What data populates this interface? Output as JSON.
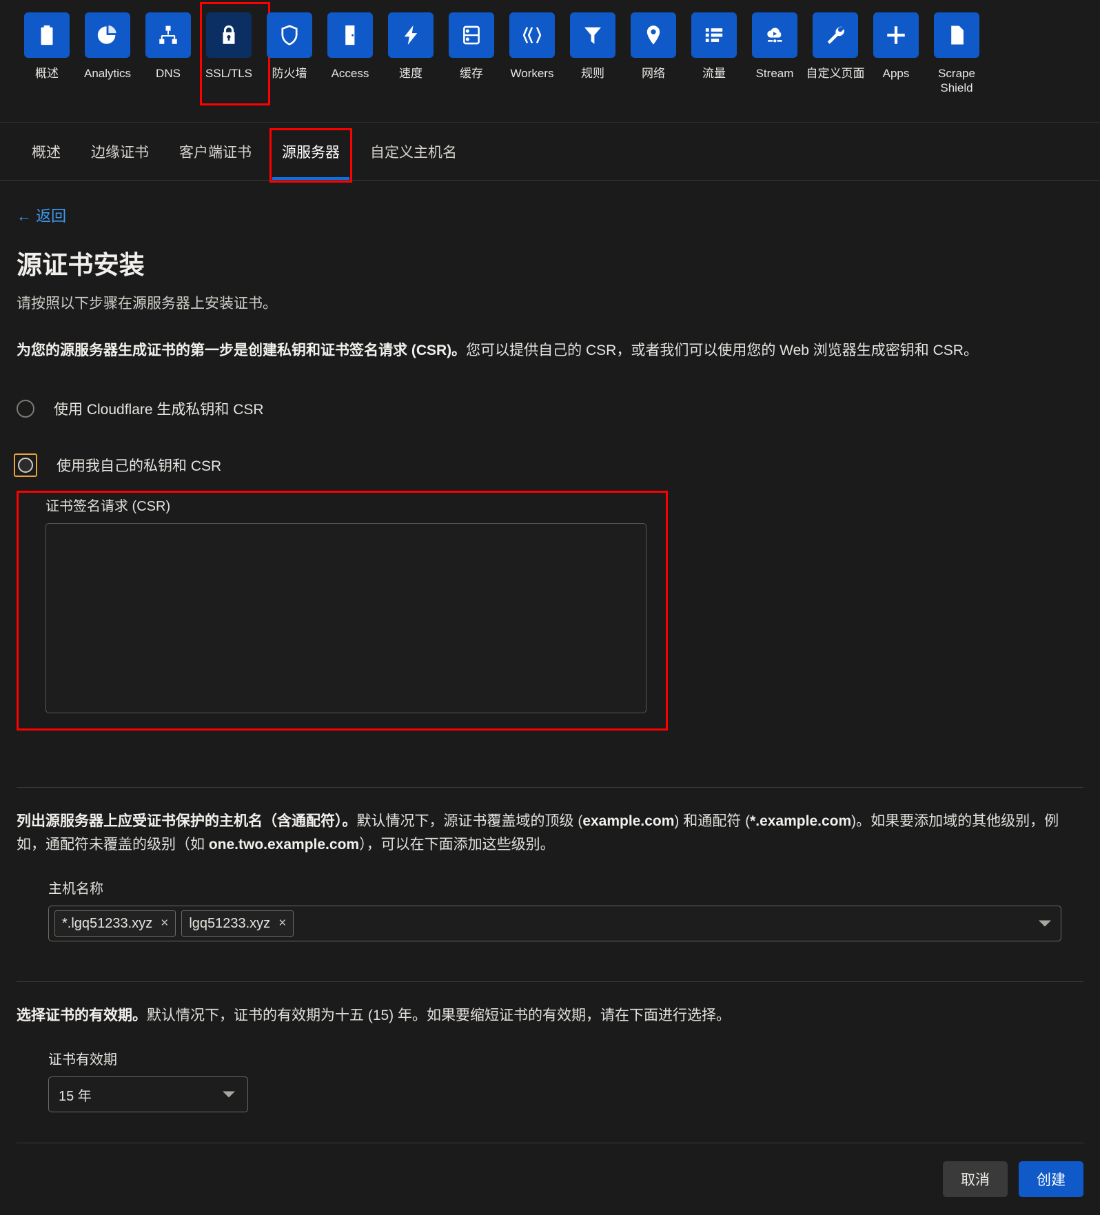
{
  "topnav": {
    "items": [
      {
        "label": "概述",
        "icon": "clipboard-icon",
        "active": false
      },
      {
        "label": "Analytics",
        "icon": "pie-chart-icon",
        "active": false
      },
      {
        "label": "DNS",
        "icon": "sitemap-icon",
        "active": false
      },
      {
        "label": "SSL/TLS",
        "icon": "lock-icon",
        "active": true
      },
      {
        "label": "防火墙",
        "icon": "shield-icon",
        "active": false
      },
      {
        "label": "Access",
        "icon": "door-icon",
        "active": false
      },
      {
        "label": "速度",
        "icon": "lightning-bolt-icon",
        "active": false
      },
      {
        "label": "缓存",
        "icon": "server-stack-icon",
        "active": false
      },
      {
        "label": "Workers",
        "icon": "workers-chevrons-icon",
        "active": false
      },
      {
        "label": "规则",
        "icon": "funnel-icon",
        "active": false
      },
      {
        "label": "网络",
        "icon": "map-pin-icon",
        "active": false
      },
      {
        "label": "流量",
        "icon": "list-icon",
        "active": false
      },
      {
        "label": "Stream",
        "icon": "stream-cloud-play-icon",
        "active": false
      },
      {
        "label": "自定义页面",
        "icon": "wrench-icon",
        "active": false
      },
      {
        "label": "Apps",
        "icon": "plus-icon",
        "active": false
      },
      {
        "label": "Scrape\nShield",
        "icon": "document-icon",
        "active": false
      }
    ]
  },
  "subtabs": {
    "items": [
      {
        "label": "概述",
        "active": false
      },
      {
        "label": "边缘证书",
        "active": false
      },
      {
        "label": "客户端证书",
        "active": false
      },
      {
        "label": "源服务器",
        "active": true
      },
      {
        "label": "自定义主机名",
        "active": false
      }
    ]
  },
  "page": {
    "back_label": "← 返回",
    "title": "源证书安装",
    "subtitle": "请按照以下步骤在源服务器上安装证书。",
    "lead_bold": "为您的源服务器生成证书的第一步是创建私钥和证书签名请求 (CSR)。",
    "lead_rest": "您可以提供自己的 CSR，或者我们可以使用您的 Web 浏览器生成密钥和 CSR。"
  },
  "key_options": {
    "option_cloudflare": "使用 Cloudflare 生成私钥和 CSR",
    "option_own": "使用我自己的私钥和 CSR",
    "selected": "option_own"
  },
  "csr": {
    "label": "证书签名请求 (CSR)",
    "value": "",
    "placeholder": ""
  },
  "hostnames": {
    "para_bold": "列出源服务器上应受证书保护的主机名（含通配符）。",
    "para_rest_1": "默认情况下，源证书覆盖域的顶级 (",
    "para_example_1": "example.com",
    "para_rest_2": ") 和通配符 (",
    "para_example_2": "*.example.com",
    "para_rest_3": ")。如果要添加域的其他级别，例如，通配符未覆盖的级别（如 ",
    "para_example_3": "one.two.example.com",
    "para_rest_4": "），可以在下面添加这些级别。",
    "label": "主机名称",
    "tags": [
      "*.lgq51233.xyz",
      "lgq51233.xyz"
    ],
    "remove_glyph": "×"
  },
  "validity": {
    "para_bold": "选择证书的有效期。",
    "para_rest": "默认情况下，证书的有效期为十五 (15) 年。如果要缩短证书的有效期，请在下面进行选择。",
    "label": "证书有效期",
    "selected": "15 年"
  },
  "footer": {
    "cancel": "取消",
    "create": "创建"
  },
  "colors": {
    "accent_blue": "#0f59c9",
    "tab_underline": "#0f6fe0",
    "annotation_red": "#ff0000",
    "focus_orange": "#e8a33d",
    "link_blue": "#3e9bf0",
    "background": "#1b1b1b"
  }
}
